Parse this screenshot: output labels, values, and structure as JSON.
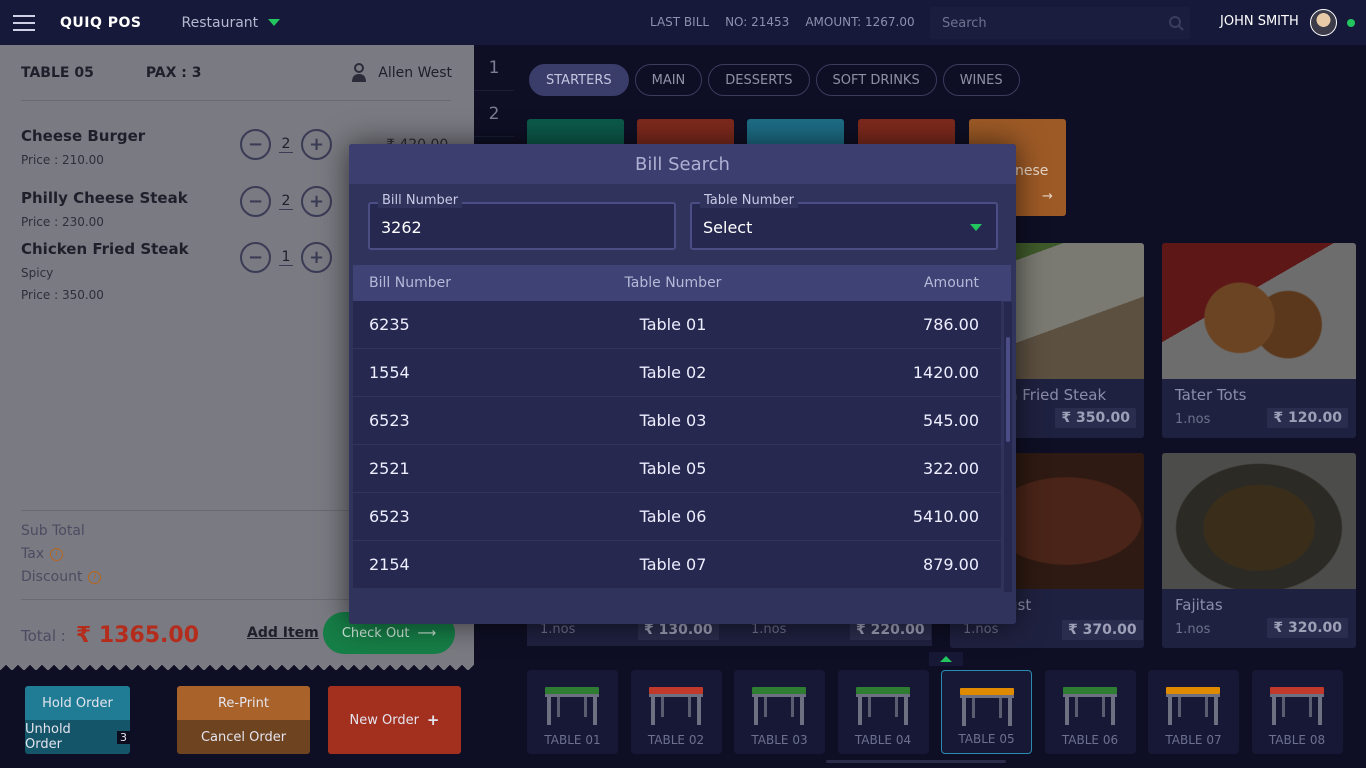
{
  "app": {
    "brand": "QUIQ POS",
    "outlet": "Restaurant",
    "last_bill_label": "LAST BILL",
    "last_bill_no": "NO: 21453",
    "last_bill_amount": "AMOUNT: 1267.00",
    "search_placeholder": "Search",
    "user": "JOHN SMITH"
  },
  "order": {
    "table": "TABLE 05",
    "pax": "PAX : 3",
    "waiter": "Allen West",
    "items": [
      {
        "name": "Cheese Burger",
        "line2": "Price  : 210.00",
        "qty": "2"
      },
      {
        "name": "Philly Cheese Steak",
        "line2": "Price  : 230.00",
        "qty": "2"
      },
      {
        "name": "Chicken Fried Steak",
        "line2": "Spicy",
        "line3": "Price  : 350.00",
        "qty": "1"
      }
    ],
    "first_amount": "₹ 420.00",
    "subtotal_label": "Sub Total",
    "tax_label": "Tax",
    "discount_label": "Discount",
    "total_label": "Total :",
    "total_value": "₹ 1365.00",
    "add_item": "Add Item",
    "checkout": "Check Out"
  },
  "actions": {
    "hold": "Hold Order",
    "unhold": "Unhold Order",
    "unhold_count": "3",
    "reprint": "Re-Print",
    "cancel": "Cancel Order",
    "new": "New Order"
  },
  "rail": [
    "1",
    "2"
  ],
  "categories": [
    "STARTERS",
    "MAIN",
    "DESSERTS",
    "SOFT DRINKS",
    "WINES"
  ],
  "tile_partial_text": "nese",
  "foods": [
    {
      "name": "n Fried Steak",
      "price": "₹ 350.00"
    },
    {
      "name": "Tater Tots",
      "qty": "1.nos",
      "price": "₹ 120.00"
    },
    {
      "name": "ust",
      "price": "₹ 370.00"
    },
    {
      "name": "Fajitas",
      "qty": "1.nos",
      "price": "₹ 320.00"
    }
  ],
  "bottom_row": [
    {
      "qty": "1.nos",
      "price": "₹ 130.00"
    },
    {
      "qty": "1.nos",
      "price": "₹ 220.00"
    },
    {
      "qty": "1.nos",
      "price": "₹ 370.00"
    }
  ],
  "tables": [
    "TABLE 01",
    "TABLE 02",
    "TABLE 03",
    "TABLE 04",
    "TABLE 05",
    "TABLE 06",
    "TABLE 07",
    "TABLE 08"
  ],
  "table_colors": [
    "#2e7d32",
    "#c0392b",
    "#2e7d32",
    "#2e7d32",
    "#e08a00",
    "#2e7d32",
    "#e08a00",
    "#c0392b"
  ],
  "modal": {
    "title": "Bill Search",
    "bill_label": "Bill Number",
    "bill_value": "3262",
    "table_label": "Table Number",
    "table_value": "Select",
    "headers": [
      "Bill Number",
      "Table Number",
      "Amount"
    ],
    "rows": [
      [
        "6235",
        "Table 01",
        "786.00"
      ],
      [
        "1554",
        "Table 02",
        "1420.00"
      ],
      [
        "6523",
        "Table 03",
        "545.00"
      ],
      [
        "2521",
        "Table 05",
        "322.00"
      ],
      [
        "6523",
        "Table 06",
        "5410.00"
      ],
      [
        "2154",
        "Table 07",
        "879.00"
      ]
    ]
  }
}
